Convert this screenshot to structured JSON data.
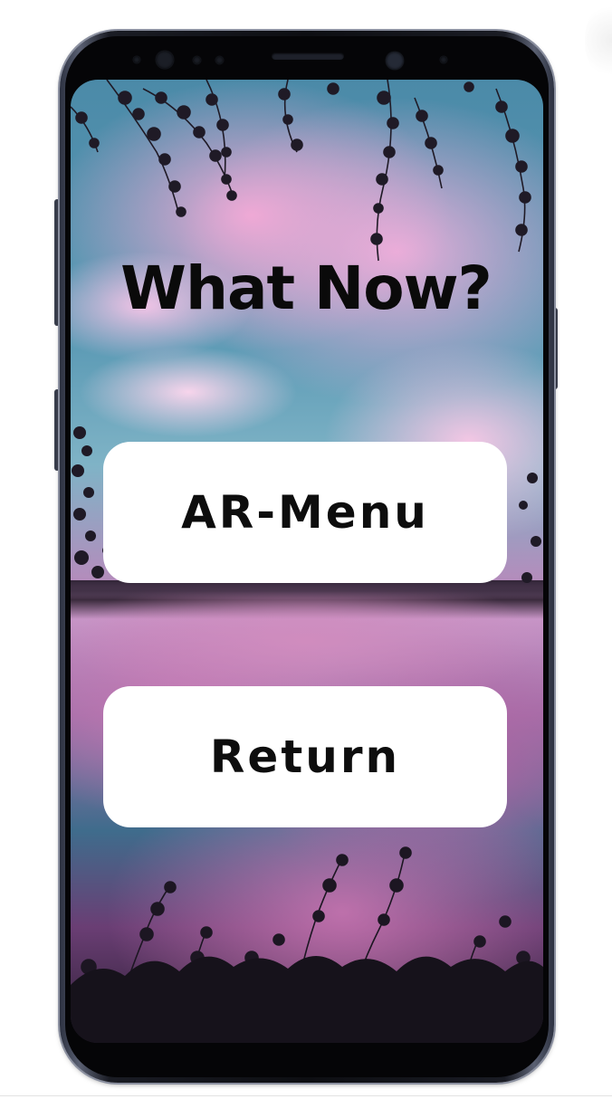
{
  "screen": {
    "title": "What Now?",
    "buttons": {
      "ar_menu": "AR-Menu",
      "return": "Return"
    }
  },
  "colors": {
    "button_background": "#ffffff",
    "text": "#0a0a0a",
    "phone_frame": "#0d0e12"
  },
  "icons": {
    "front_camera": "front-camera-icon",
    "earpiece": "speaker-grille-icon"
  }
}
